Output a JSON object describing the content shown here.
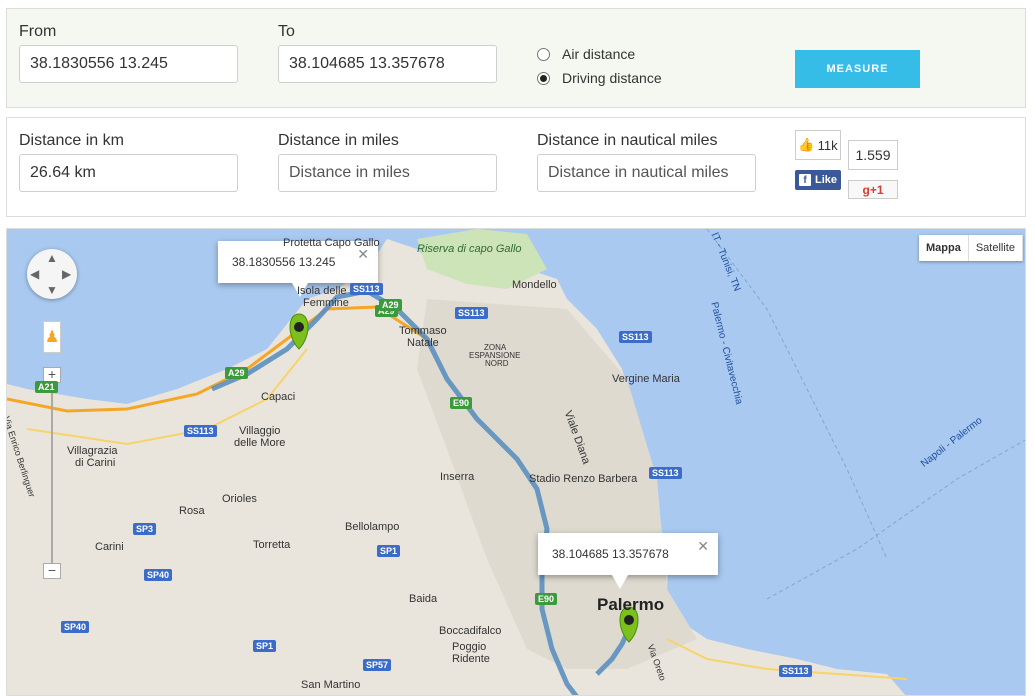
{
  "form": {
    "from_label": "From",
    "from_value": "38.1830556 13.245",
    "to_label": "To",
    "to_value": "38.104685 13.357678",
    "air_label": "Air distance",
    "driving_label": "Driving distance",
    "selected_mode": "driving",
    "measure_label": "MEASURE"
  },
  "results": {
    "km_label": "Distance in km",
    "km_value": "26.64 km",
    "miles_label": "Distance in miles",
    "miles_placeholder": "Distance in miles",
    "nautical_label": "Distance in nautical miles",
    "nautical_placeholder": "Distance in nautical miles"
  },
  "social": {
    "fb_count": "11k",
    "fb_label": "Like",
    "gplus_count": "1.559",
    "gplus_label": "g+1"
  },
  "map": {
    "type_map": "Mappa",
    "type_satellite": "Satellite",
    "infowin_from": "38.1830556 13.245",
    "infowin_to": "38.104685 13.357678",
    "route_color": "#5b8fc0",
    "sea_color": "#a9c9f0",
    "land_color": "#e9e5dc",
    "marker_color": "#7bc01c",
    "places": {
      "palermo": "Palermo",
      "mondello": "Mondello",
      "tommaso": "Tommaso",
      "natale": "Natale",
      "capaci": "Capaci",
      "villaggio": "Villaggio",
      "delle_more": "delle More",
      "villagrazia": "Villagrazia",
      "di_carini": "di Carini",
      "carini": "Carini",
      "orioles": "Orioles",
      "rosa": "Rosa",
      "torretta": "Torretta",
      "bellolampo": "Bellolampo",
      "inserra": "Inserra",
      "baida": "Baida",
      "boccadifalco": "Boccadifalco",
      "poggio": "Poggio",
      "ridente": "Ridente",
      "san_martino": "San Martino",
      "vergine_maria": "Vergine Maria",
      "stadio": "Stadio Renzo Barbera",
      "viale_diana": "Viale Diana",
      "riserva": "Riserva di capo Gallo",
      "zona": "ZONA",
      "espansione": "ESPANSIONE",
      "nord": "NORD",
      "isola": "Isola delle",
      "femmine": "Femmine",
      "capo_gallo": "Protetta Capo Gallo",
      "enrico": "Via Enrico Berlinguer",
      "via_oreto": "Via Oreto",
      "sea_tunisi": "IT - Tunisi, TN",
      "sea_civitavecchia": "Palermo - Civitavecchia",
      "sea_napoli": "Napoli - Palermo"
    },
    "shields": {
      "ss113_a": "SS113",
      "ss113_b": "SS113",
      "ss113_c": "SS113",
      "ss113_d": "SS113",
      "ss113_e": "SS113",
      "ss113_f": "SS113",
      "a29_a": "A29",
      "a29_b": "A29",
      "a29_c": "A29",
      "a21": "A21",
      "e90_a": "E90",
      "e90_b": "E90",
      "sp3": "SP3",
      "sp40_a": "SP40",
      "sp40_b": "SP40",
      "sp1_a": "SP1",
      "sp1_b": "SP1",
      "sp57": "SP57"
    }
  }
}
